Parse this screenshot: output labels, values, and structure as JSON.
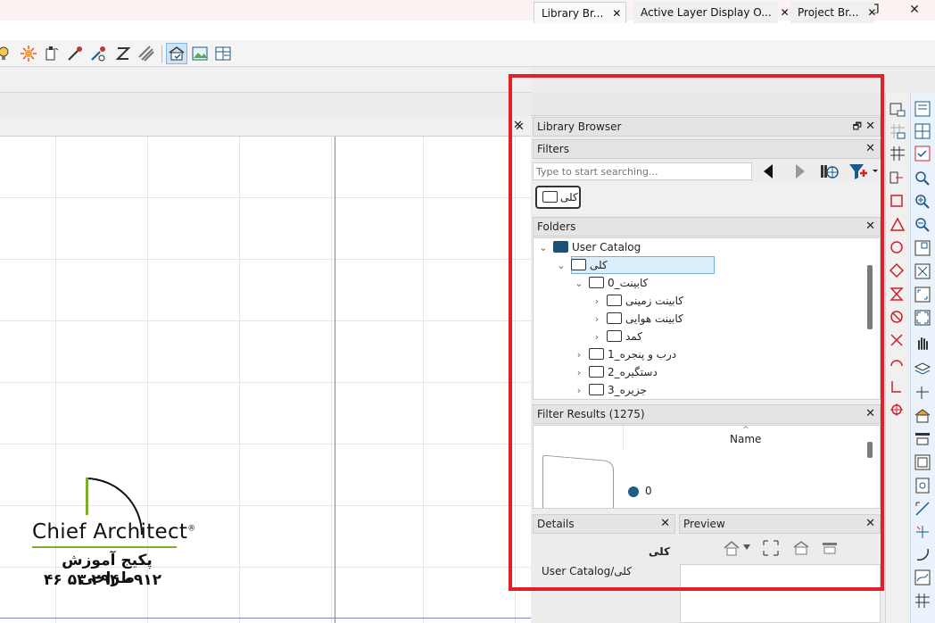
{
  "window": {
    "minimize_glyph": "—",
    "maximize_glyph": "❐",
    "close_glyph": "✕"
  },
  "toolbar": {
    "icons": [
      "light-bulb-icon",
      "sun-icon",
      "camera-icon",
      "eyedropper-icon",
      "material-painter-icon",
      "adjust-material-icon",
      "pattern-icon",
      "layer-display-icon",
      "view-icon",
      "layout-icon"
    ]
  },
  "drawing": {
    "close_glyph": "✕"
  },
  "watermark": {
    "brand": "Chief Architect",
    "brand_mark": "®",
    "line1": "پکیج آموزش طراحی",
    "line2": "۰۹۱۲ ۲۹۴ ۵۳ ۴۶"
  },
  "tabs": [
    {
      "label": "Library Br...",
      "close": "✕"
    },
    {
      "label": "Active Layer Display O...",
      "close": "✕"
    },
    {
      "label": "Project Br...",
      "close": "✕"
    }
  ],
  "library_browser": {
    "title": "Library Browser",
    "close": "✕"
  },
  "filters": {
    "title": "Filters",
    "close": "✕",
    "search_placeholder": "Type to start searching...",
    "chip_label": "کلی"
  },
  "folders": {
    "title": "Folders",
    "close": "✕",
    "items": [
      {
        "label": "User Catalog",
        "chevron": "⌄"
      },
      {
        "label": "کلی",
        "chevron": "⌄"
      },
      {
        "label": "کابینت_0",
        "chevron": "⌄"
      },
      {
        "label": "کابینت زمینی",
        "chevron": "›"
      },
      {
        "label": "کابینت هوایی",
        "chevron": "›"
      },
      {
        "label": "کمد",
        "chevron": "›"
      },
      {
        "label": "درب و پنجره_1",
        "chevron": "›"
      },
      {
        "label": "دستگیره_2",
        "chevron": "›"
      },
      {
        "label": "جزیره_3",
        "chevron": "›"
      }
    ]
  },
  "filter_results": {
    "title": "Filter Results (1275)",
    "close": "✕",
    "column_name": "Name",
    "sort_glyph": "^",
    "first_item_value": "0"
  },
  "details": {
    "title": "Details",
    "close": "✕",
    "item_name": "کلی",
    "item_path": "User Catalog/کلی"
  },
  "preview": {
    "title": "Preview",
    "close": "✕"
  },
  "colors": {
    "highlight_frame": "#e0202a",
    "selection": "#dbeefb",
    "folder_accent": "#1b4f73",
    "brand_green": "#7fae2f"
  }
}
